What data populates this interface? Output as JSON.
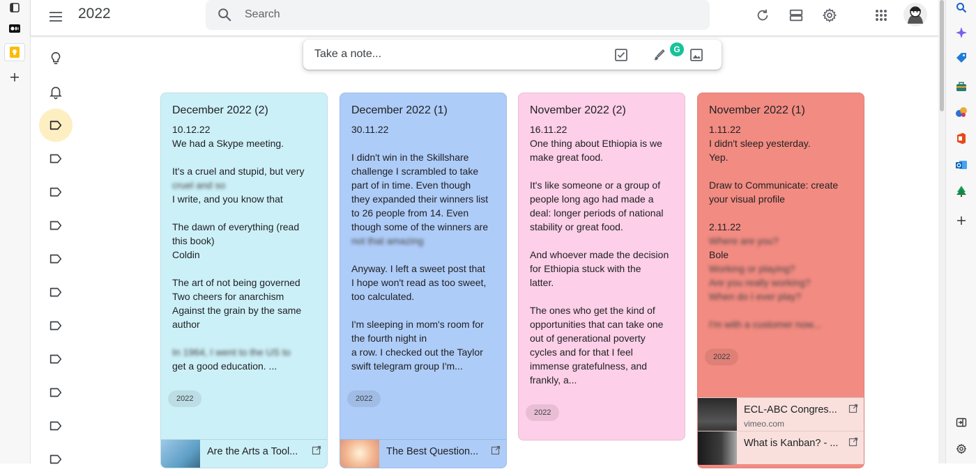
{
  "app": {
    "title": "2022"
  },
  "search": {
    "placeholder": "Search"
  },
  "take_note": {
    "placeholder": "Take a note..."
  },
  "grammarly": {
    "label": "G"
  },
  "sidebar": {
    "items": [
      "notes",
      "reminders",
      "label-active",
      "label",
      "label",
      "label",
      "label",
      "label",
      "label",
      "label",
      "label",
      "label",
      "label"
    ]
  },
  "notes": [
    {
      "title": "December 2022 (2)",
      "color": "#ccf0f8",
      "body_lines": [
        "10.12.22",
        "We had a Skype meeting.",
        "",
        "It's a cruel and stupid, but very"
      ],
      "blurred_1": "cruel and so",
      "body_lines_2": [
        "I write, and you know that",
        "",
        "The dawn of everything (read",
        "this book)",
        "Coldin",
        "",
        "The art of not being governed",
        "Two cheers for anarchism",
        "Against the grain by the same",
        "author",
        ""
      ],
      "blurred_2": "In 1964, I went to the US to",
      "body_last": "get a good education. ...",
      "tag": "2022",
      "link": {
        "title": "Are the Arts a Tool...",
        "domain": ""
      }
    },
    {
      "title": "December 2022 (1)",
      "color": "#aeccf8",
      "body_lines": [
        "30.11.22",
        "",
        "I didn't win in the Skillshare",
        "challenge I scrambled to take",
        "part of in time. Even though",
        "they expanded their winners list",
        "to 26 people from 14. Even",
        "though some of the winners are"
      ],
      "blurred_1": "not that amazing",
      "body_lines_2": [
        "",
        "Anyway. I left a sweet post that",
        "I hope won't read as too sweet,",
        "too calculated.",
        "",
        "I'm sleeping in mom's room for",
        "the fourth night in",
        "a row. I checked out the Taylor",
        "swift telegram group I'm..."
      ],
      "tag": "2022",
      "link": {
        "title": "The Best Question...",
        "domain": ""
      }
    },
    {
      "title": "November 2022 (2)",
      "color": "#fdcfe8",
      "body_lines": [
        "16.11.22",
        "One thing about Ethiopia is we",
        "make great food.",
        "",
        "It's like someone or a group of",
        "people long ago had made a",
        "deal: longer periods of national",
        "stability or great food.",
        "",
        "And whoever made the decision",
        "for Ethiopia stuck with the",
        "latter.",
        "",
        "The ones who get the kind of",
        "opportunities that can take one",
        "out of generational poverty",
        "cycles and for that I feel",
        "immense gratefulness, and",
        "frankly, a..."
      ],
      "tag": "2022"
    },
    {
      "title": "November 2022 (1)",
      "color": "#f28b82",
      "body_lines": [
        "1.11.22",
        "I didn't sleep yesterday.",
        "Yep.",
        "",
        "Draw to Communicate: create",
        "your visual profile",
        "",
        "2.11.22"
      ],
      "blurred_1": "Where are you?",
      "body_after": [
        "Bole"
      ],
      "blurred_2": "Working or playing?",
      "blurred_3": "Are you really working?",
      "blurred_4": "When do I ever play?",
      "body_after_2": [
        ""
      ],
      "blurred_5": "I'm with a customer now...",
      "tag": "2022",
      "links": [
        {
          "title": "ECL-ABC Congres...",
          "domain": "vimeo.com"
        },
        {
          "title": "What is Kanban? - ...",
          "domain": ""
        }
      ]
    }
  ],
  "colors": {
    "accent_active": "#feefc3",
    "header_border": "#dadce0"
  }
}
